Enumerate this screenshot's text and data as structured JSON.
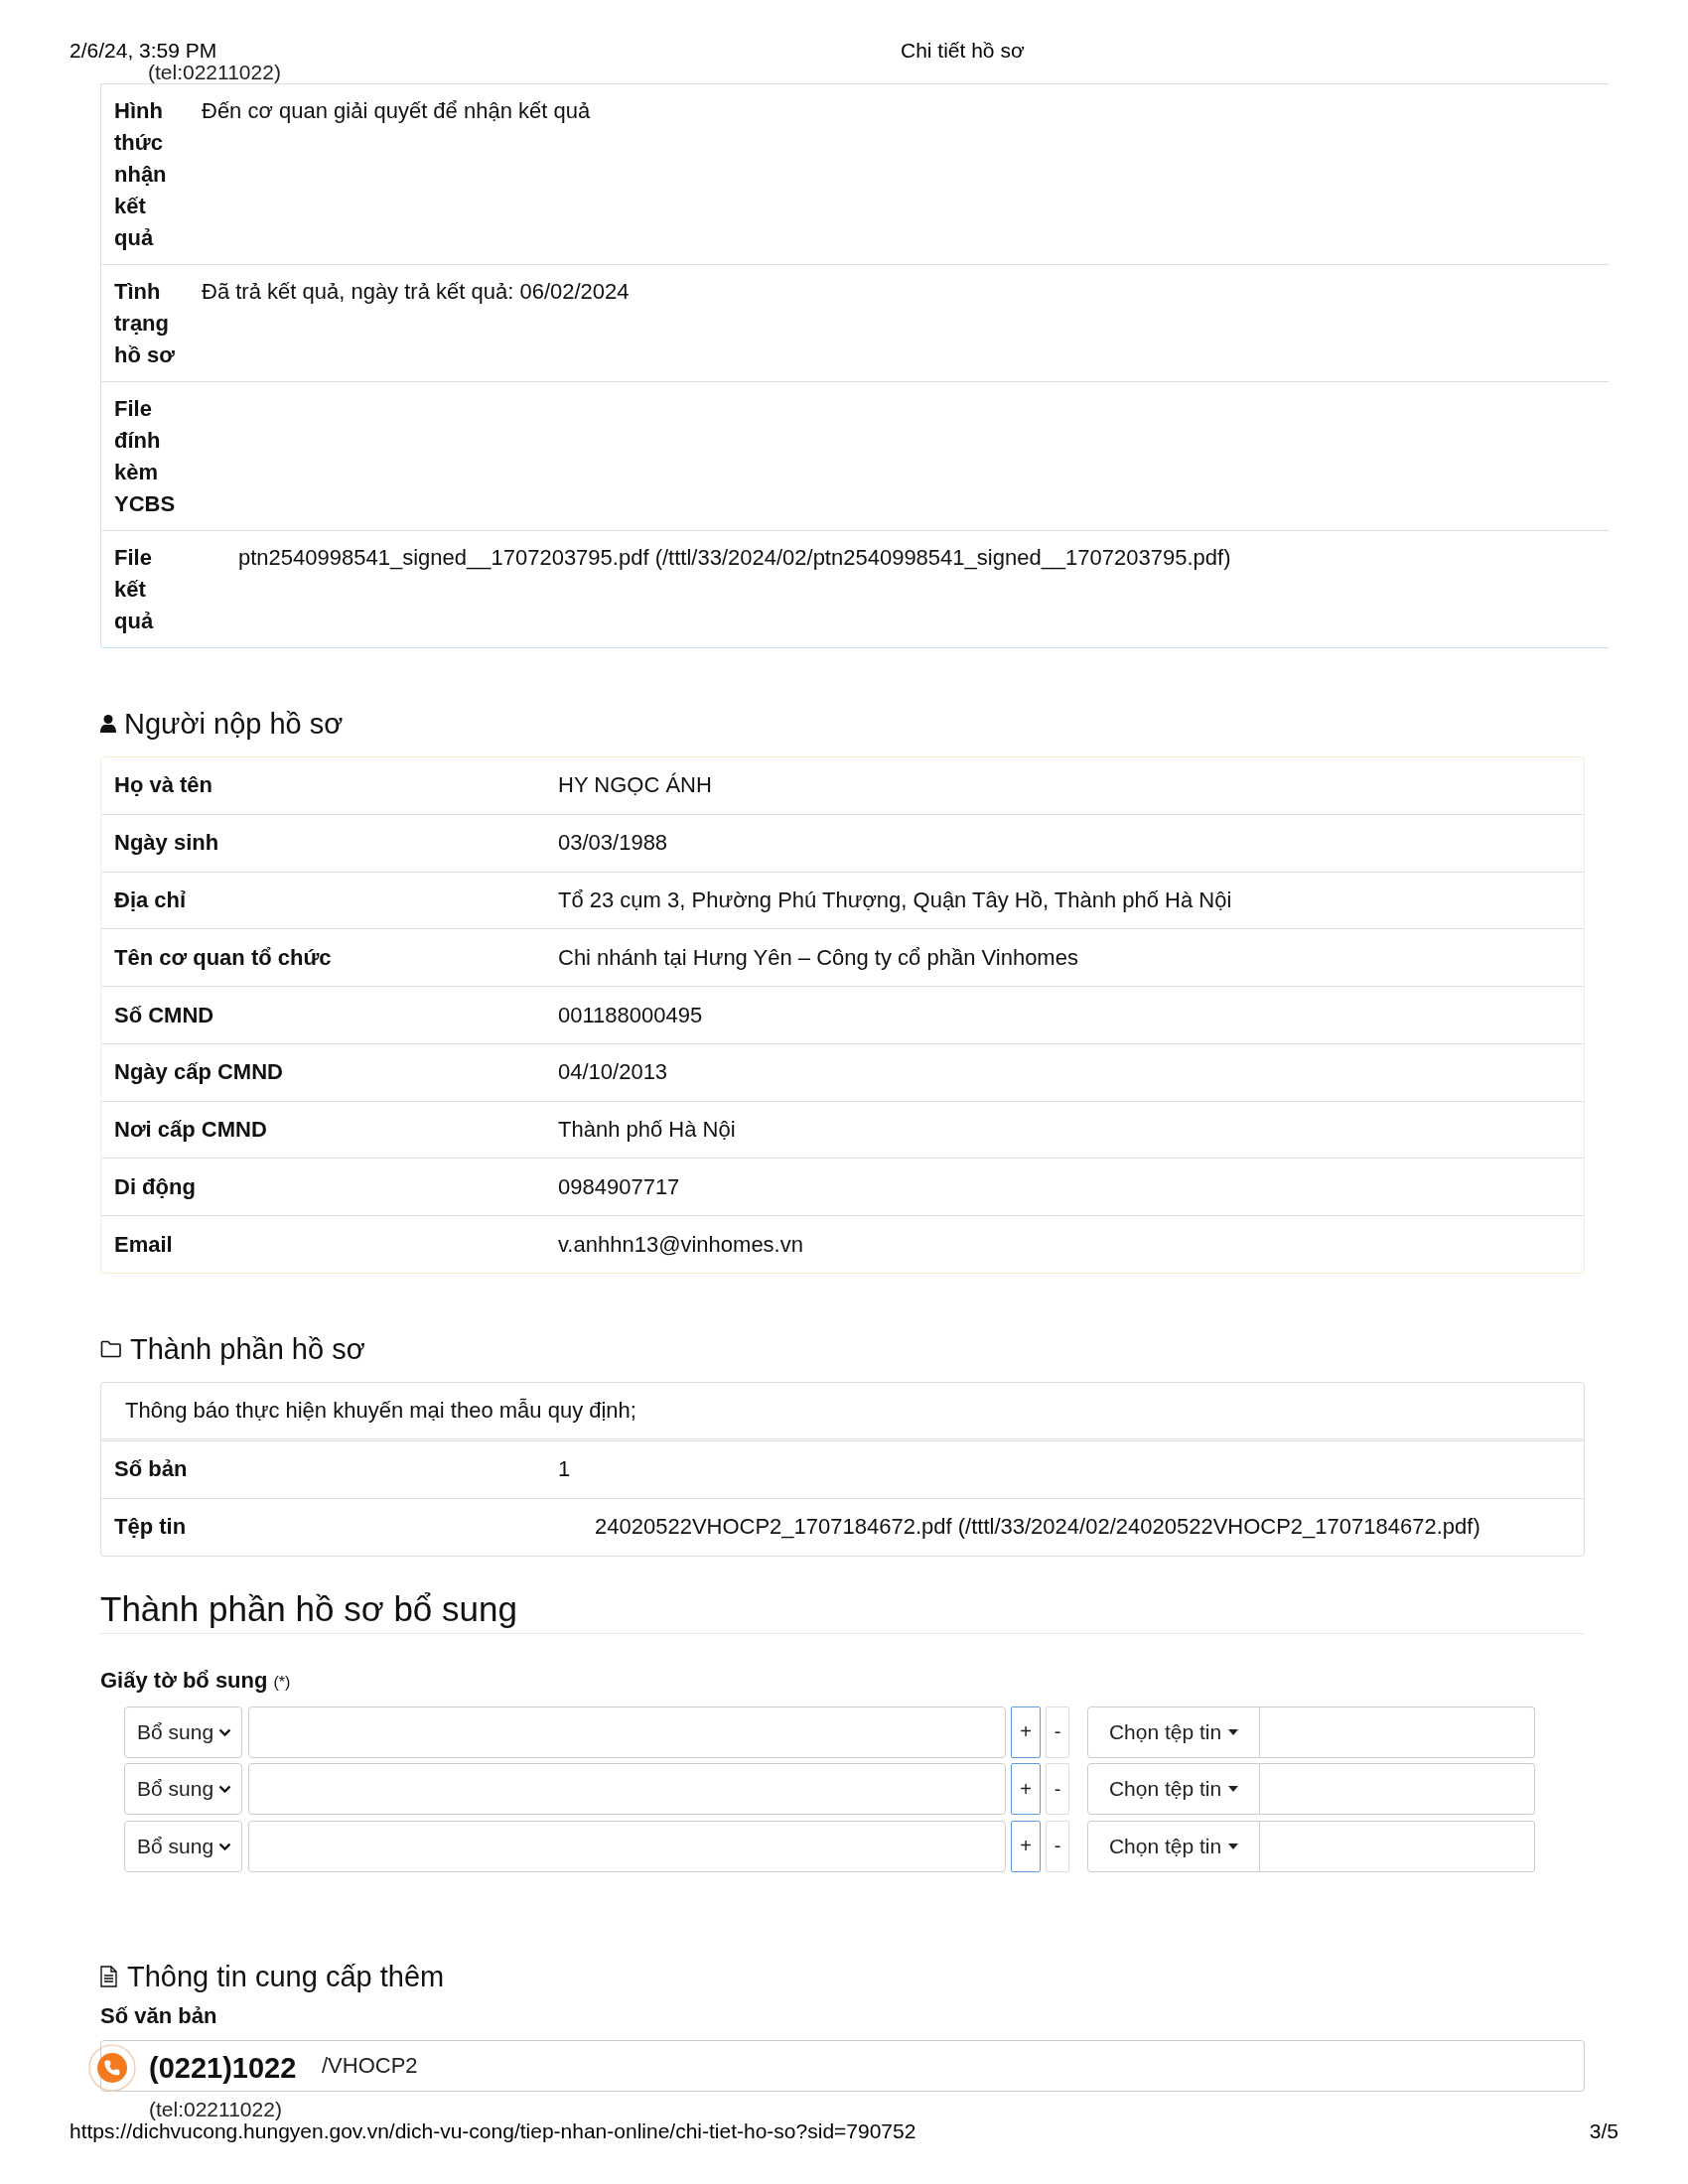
{
  "header": {
    "date": "2/6/24, 3:59 PM",
    "title": "Chi tiết hồ sơ"
  },
  "page_top_fragment": "(tel:02211022)",
  "result_details": {
    "rows": [
      {
        "label": "Hình thức nhận kết quả",
        "value": "Đến cơ quan giải quyết để nhận kết quả",
        "kind": "text"
      },
      {
        "label": "Tình trạng hồ sơ",
        "value": "Đã trả kết quả, ngày trả kết quả: 06/02/2024",
        "kind": "text"
      },
      {
        "label": "File đính kèm YCBS",
        "kind": "text"
      },
      {
        "label": "File kết quả",
        "value": "ptn2540998541_signed__1707203795.pdf (/tttl/33/2024/02/ptn2540998541_signed__1707203795.pdf)",
        "kind": "file"
      }
    ]
  },
  "applicant": {
    "title": "Người nộp hồ sơ",
    "rows": [
      {
        "label": "Họ và tên",
        "value": "HY NGỌC ÁNH"
      },
      {
        "label": "Ngày sinh",
        "value": "03/03/1988"
      },
      {
        "label": "Địa chỉ",
        "value": "Tổ 23 cụm 3, Phường Phú Thượng, Quận Tây Hồ, Thành phố Hà Nội"
      },
      {
        "label": "Tên cơ quan tổ chức",
        "value": "Chi nhánh tại Hưng Yên – Công ty cổ phần Vinhomes"
      },
      {
        "label": "Số CMND",
        "value": "001188000495"
      },
      {
        "label": "Ngày cấp CMND",
        "value": "04/10/2013"
      },
      {
        "label": "Nơi cấp CMND",
        "value": "Thành phố Hà Nội"
      },
      {
        "label": "Di động",
        "value": "0984907717"
      },
      {
        "label": "Email",
        "value": "v.anhhn13@vinhomes.vn"
      }
    ]
  },
  "documents": {
    "title": "Thành phần hồ sơ",
    "name": "Thông báo thực hiện khuyến mại theo mẫu quy định;",
    "rows": [
      {
        "label": "Số bản",
        "value": "1",
        "kind": "text"
      },
      {
        "label": "Tệp tin",
        "value": "24020522VHOCP2_1707184672.pdf (/tttl/33/2024/02/24020522VHOCP2_1707184672.pdf)",
        "kind": "file"
      }
    ]
  },
  "supplement": {
    "title": "Thành phần hồ sơ bổ sung",
    "field_label": "Giấy tờ bổ sung",
    "required_mark": "(*)",
    "rows": [
      {
        "type": "Bổ sung",
        "add": "+",
        "remove": "-",
        "file_button": "Chọn tệp tin"
      },
      {
        "type": "Bổ sung",
        "add": "+",
        "remove": "-",
        "file_button": "Chọn tệp tin"
      },
      {
        "type": "Bổ sung",
        "add": "+",
        "remove": "-",
        "file_button": "Chọn tệp tin"
      }
    ]
  },
  "extra_info": {
    "title": "Thông tin cung cấp thêm",
    "field_label": "Số văn bản",
    "value": "/VHOCP2"
  },
  "call_widget": {
    "phone": "(0221)1022",
    "link": "(tel:02211022)"
  },
  "footer": {
    "url": "https://dichvucong.hungyen.gov.vn/dich-vu-cong/tiep-nhan-online/chi-tiet-ho-so?sid=790752",
    "page": "3/5"
  }
}
